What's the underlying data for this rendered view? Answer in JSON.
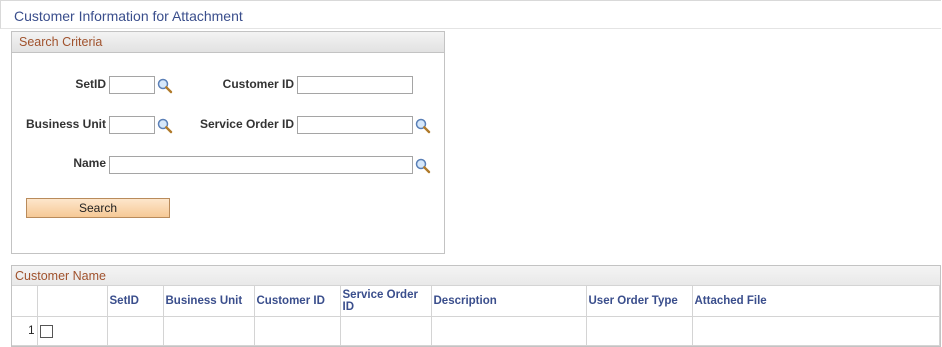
{
  "page": {
    "title": "Customer Information for Attachment"
  },
  "search_criteria": {
    "title": "Search Criteria",
    "setid_label": "SetID",
    "setid_value": "",
    "customer_id_label": "Customer ID",
    "customer_id_value": "",
    "business_unit_label": "Business Unit",
    "business_unit_value": "",
    "service_order_id_label": "Service Order ID",
    "service_order_id_value": "",
    "name_label": "Name",
    "name_value": "",
    "search_button": "Search"
  },
  "results": {
    "title": "Customer Name",
    "columns": [
      "SetID",
      "Business Unit",
      "Customer ID",
      "Service Order ID",
      "Description",
      "User Order Type",
      "Attached File"
    ],
    "rows": [
      {
        "row_number": "1",
        "selected": false,
        "setid": "",
        "business_unit": "",
        "customer_id": "",
        "service_order_id": "",
        "description": "",
        "user_order_type": "",
        "attached_file": ""
      }
    ]
  },
  "colors": {
    "title_blue": "#3a4e8c",
    "section_title_brown": "#a0522d",
    "button_fill": "#f6c996"
  }
}
